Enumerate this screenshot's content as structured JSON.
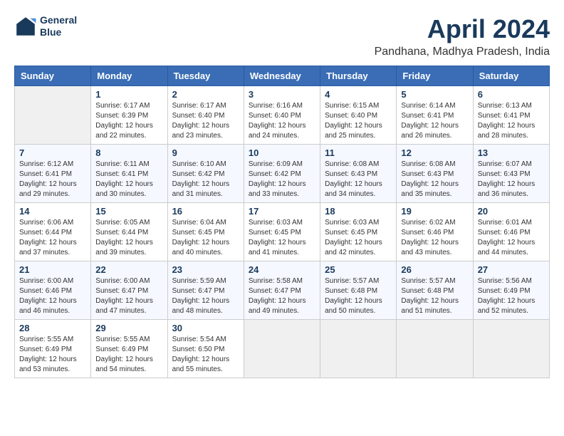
{
  "header": {
    "logo_line1": "General",
    "logo_line2": "Blue",
    "month": "April 2024",
    "location": "Pandhana, Madhya Pradesh, India"
  },
  "days_of_week": [
    "Sunday",
    "Monday",
    "Tuesday",
    "Wednesday",
    "Thursday",
    "Friday",
    "Saturday"
  ],
  "weeks": [
    [
      {
        "day": "",
        "sunrise": "",
        "sunset": "",
        "daylight": ""
      },
      {
        "day": "1",
        "sunrise": "Sunrise: 6:17 AM",
        "sunset": "Sunset: 6:39 PM",
        "daylight": "Daylight: 12 hours and 22 minutes."
      },
      {
        "day": "2",
        "sunrise": "Sunrise: 6:17 AM",
        "sunset": "Sunset: 6:40 PM",
        "daylight": "Daylight: 12 hours and 23 minutes."
      },
      {
        "day": "3",
        "sunrise": "Sunrise: 6:16 AM",
        "sunset": "Sunset: 6:40 PM",
        "daylight": "Daylight: 12 hours and 24 minutes."
      },
      {
        "day": "4",
        "sunrise": "Sunrise: 6:15 AM",
        "sunset": "Sunset: 6:40 PM",
        "daylight": "Daylight: 12 hours and 25 minutes."
      },
      {
        "day": "5",
        "sunrise": "Sunrise: 6:14 AM",
        "sunset": "Sunset: 6:41 PM",
        "daylight": "Daylight: 12 hours and 26 minutes."
      },
      {
        "day": "6",
        "sunrise": "Sunrise: 6:13 AM",
        "sunset": "Sunset: 6:41 PM",
        "daylight": "Daylight: 12 hours and 28 minutes."
      }
    ],
    [
      {
        "day": "7",
        "sunrise": "Sunrise: 6:12 AM",
        "sunset": "Sunset: 6:41 PM",
        "daylight": "Daylight: 12 hours and 29 minutes."
      },
      {
        "day": "8",
        "sunrise": "Sunrise: 6:11 AM",
        "sunset": "Sunset: 6:41 PM",
        "daylight": "Daylight: 12 hours and 30 minutes."
      },
      {
        "day": "9",
        "sunrise": "Sunrise: 6:10 AM",
        "sunset": "Sunset: 6:42 PM",
        "daylight": "Daylight: 12 hours and 31 minutes."
      },
      {
        "day": "10",
        "sunrise": "Sunrise: 6:09 AM",
        "sunset": "Sunset: 6:42 PM",
        "daylight": "Daylight: 12 hours and 33 minutes."
      },
      {
        "day": "11",
        "sunrise": "Sunrise: 6:08 AM",
        "sunset": "Sunset: 6:43 PM",
        "daylight": "Daylight: 12 hours and 34 minutes."
      },
      {
        "day": "12",
        "sunrise": "Sunrise: 6:08 AM",
        "sunset": "Sunset: 6:43 PM",
        "daylight": "Daylight: 12 hours and 35 minutes."
      },
      {
        "day": "13",
        "sunrise": "Sunrise: 6:07 AM",
        "sunset": "Sunset: 6:43 PM",
        "daylight": "Daylight: 12 hours and 36 minutes."
      }
    ],
    [
      {
        "day": "14",
        "sunrise": "Sunrise: 6:06 AM",
        "sunset": "Sunset: 6:44 PM",
        "daylight": "Daylight: 12 hours and 37 minutes."
      },
      {
        "day": "15",
        "sunrise": "Sunrise: 6:05 AM",
        "sunset": "Sunset: 6:44 PM",
        "daylight": "Daylight: 12 hours and 39 minutes."
      },
      {
        "day": "16",
        "sunrise": "Sunrise: 6:04 AM",
        "sunset": "Sunset: 6:45 PM",
        "daylight": "Daylight: 12 hours and 40 minutes."
      },
      {
        "day": "17",
        "sunrise": "Sunrise: 6:03 AM",
        "sunset": "Sunset: 6:45 PM",
        "daylight": "Daylight: 12 hours and 41 minutes."
      },
      {
        "day": "18",
        "sunrise": "Sunrise: 6:03 AM",
        "sunset": "Sunset: 6:45 PM",
        "daylight": "Daylight: 12 hours and 42 minutes."
      },
      {
        "day": "19",
        "sunrise": "Sunrise: 6:02 AM",
        "sunset": "Sunset: 6:46 PM",
        "daylight": "Daylight: 12 hours and 43 minutes."
      },
      {
        "day": "20",
        "sunrise": "Sunrise: 6:01 AM",
        "sunset": "Sunset: 6:46 PM",
        "daylight": "Daylight: 12 hours and 44 minutes."
      }
    ],
    [
      {
        "day": "21",
        "sunrise": "Sunrise: 6:00 AM",
        "sunset": "Sunset: 6:46 PM",
        "daylight": "Daylight: 12 hours and 46 minutes."
      },
      {
        "day": "22",
        "sunrise": "Sunrise: 6:00 AM",
        "sunset": "Sunset: 6:47 PM",
        "daylight": "Daylight: 12 hours and 47 minutes."
      },
      {
        "day": "23",
        "sunrise": "Sunrise: 5:59 AM",
        "sunset": "Sunset: 6:47 PM",
        "daylight": "Daylight: 12 hours and 48 minutes."
      },
      {
        "day": "24",
        "sunrise": "Sunrise: 5:58 AM",
        "sunset": "Sunset: 6:47 PM",
        "daylight": "Daylight: 12 hours and 49 minutes."
      },
      {
        "day": "25",
        "sunrise": "Sunrise: 5:57 AM",
        "sunset": "Sunset: 6:48 PM",
        "daylight": "Daylight: 12 hours and 50 minutes."
      },
      {
        "day": "26",
        "sunrise": "Sunrise: 5:57 AM",
        "sunset": "Sunset: 6:48 PM",
        "daylight": "Daylight: 12 hours and 51 minutes."
      },
      {
        "day": "27",
        "sunrise": "Sunrise: 5:56 AM",
        "sunset": "Sunset: 6:49 PM",
        "daylight": "Daylight: 12 hours and 52 minutes."
      }
    ],
    [
      {
        "day": "28",
        "sunrise": "Sunrise: 5:55 AM",
        "sunset": "Sunset: 6:49 PM",
        "daylight": "Daylight: 12 hours and 53 minutes."
      },
      {
        "day": "29",
        "sunrise": "Sunrise: 5:55 AM",
        "sunset": "Sunset: 6:49 PM",
        "daylight": "Daylight: 12 hours and 54 minutes."
      },
      {
        "day": "30",
        "sunrise": "Sunrise: 5:54 AM",
        "sunset": "Sunset: 6:50 PM",
        "daylight": "Daylight: 12 hours and 55 minutes."
      },
      {
        "day": "",
        "sunrise": "",
        "sunset": "",
        "daylight": ""
      },
      {
        "day": "",
        "sunrise": "",
        "sunset": "",
        "daylight": ""
      },
      {
        "day": "",
        "sunrise": "",
        "sunset": "",
        "daylight": ""
      },
      {
        "day": "",
        "sunrise": "",
        "sunset": "",
        "daylight": ""
      }
    ]
  ]
}
